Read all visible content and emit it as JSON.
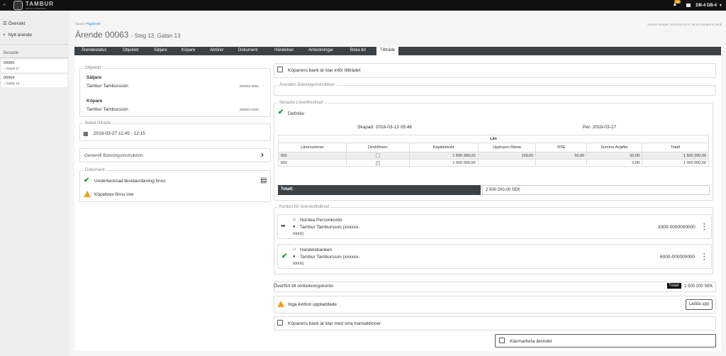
{
  "topbar": {
    "logo_text": "TAMBUR",
    "logo_sub": "DIGITALA ÄRENDEN",
    "notification_count": "16",
    "user": "DB-4 DB-4"
  },
  "sidebar": {
    "items": [
      {
        "label": "Översikt"
      },
      {
        "label": "Nytt ärende"
      }
    ],
    "recent_heading": "Senaste",
    "recent": [
      {
        "id": "00066",
        "sub": "Gatan 17"
      },
      {
        "id": "00064",
        "sub": "Gatan 14"
      }
    ]
  },
  "header": {
    "status_label": "Status:",
    "status_value": "Pågående",
    "title": "Ärende 00063",
    "subtitle": "- Steg 13, Gatan 13",
    "changed": "Senast ändrad: 2018-03-13 17:48 av Köparens bank"
  },
  "tabs": [
    "Ärendestatus",
    "Objektet",
    "Säljare",
    "Köpare",
    "Aktörer",
    "Dokument",
    "Händelser",
    "Anteckningar",
    "Boka tid",
    "Tillträde"
  ],
  "left": {
    "objektet_label": "Objektet",
    "saljare_label": "Säljare",
    "saljare_name": "Tambur Tambursson",
    "saljare_id": "xxxxxx-xxxx",
    "kopare_label": "Köpare",
    "kopare_name": "Tambur Tambursson",
    "kopare_id": "xxxxxx-xxxx",
    "bokat_label": "Bokat tillträde",
    "bokat_value": "2018-03-27 11:45 - 12:15",
    "generell": "Generell Bokningsinstruktion",
    "dokument_label": "Dokument",
    "doc1": "Undertecknad likvidavräkning finns",
    "doc2": "Köpebrev finns inte"
  },
  "right": {
    "bank_ready": "Köparens bank är klar inför tillträdet",
    "bokningsinstr_label": "Ärendets Bokningsinstruktion",
    "losen_label": "Senaste Lösenkostnad",
    "definitiv": "Definitiv",
    "skapad": "Skapad:  2018-03-13 05:46",
    "per": "Per:  2018-03-27",
    "loan_title": "Lån",
    "columns": [
      "Lånenummer",
      "Direktlösen",
      "Kapitalskuld",
      "Upplupen Ränta",
      "RSE",
      "Summa Avgifter",
      "Totalt"
    ],
    "rows": [
      {
        "nr": "001",
        "kap": "1 500 000,00",
        "ranta": "100,00",
        "rse": "50,00",
        "avg": "50,00",
        "tot": "1 500 200,00"
      },
      {
        "nr": "002",
        "kap": "1 000 000,00",
        "ranta": "",
        "rse": "",
        "avg": "0,00",
        "tot": "1 000 000,00"
      }
    ],
    "totalt_label": "Totalt:",
    "totalt_value": "2 500 200,00 SEK",
    "konton_label": "Konton för överskottslikvid",
    "acc1_bank": "Nordea Personkonto",
    "acc1_owner": "Tambur Tambursson (xxxxxx-",
    "acc1_owner2": "xxxx)",
    "acc1_nr": "3300-0000000000",
    "acc2_bank": "Handelsbanken",
    "acc2_owner": "Tambur Tambursson (xxxxxx-",
    "acc2_owner2": "xxxx)",
    "acc2_nr": "6000-000000000",
    "overfort": "Överfört till ombokningskonto",
    "overfort_total_label": "Totalt:",
    "overfort_total": "1 500 200 SEK",
    "kvitton": "Inga kvitton uppladdade",
    "ladda_upp": "Ladda upp",
    "bank_done": "Köparens bank är klar med sina transaktioner",
    "klarmarkera": "Klarmarkera ärendet"
  }
}
